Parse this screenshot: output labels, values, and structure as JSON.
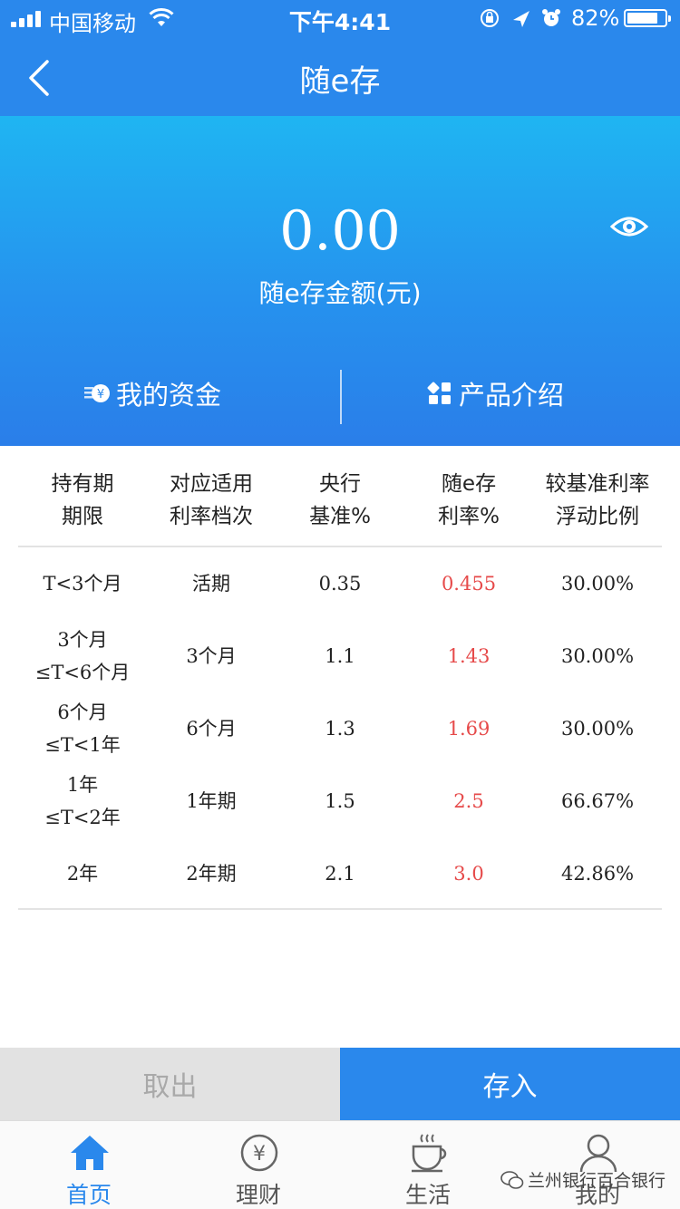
{
  "status_bar": {
    "carrier": "中国移动",
    "time": "下午4:41",
    "battery_percent": "82%",
    "battery_level": 0.82
  },
  "nav": {
    "title": "随e存",
    "back_icon": "chevron-left-icon"
  },
  "hero": {
    "amount": "0.00",
    "amount_label": "随e存金额(元)",
    "eye_icon": "eye-icon",
    "tabs": [
      {
        "label": "我的资金",
        "icon": "coin-yen-icon"
      },
      {
        "label": "产品介绍",
        "icon": "grid-apps-icon"
      }
    ]
  },
  "table": {
    "headers": [
      [
        "持有期",
        "期限"
      ],
      [
        "对应适用",
        "利率档次"
      ],
      [
        "央行",
        "基准%"
      ],
      [
        "随e存",
        "利率%"
      ],
      [
        "较基准利率",
        "浮动比例"
      ]
    ],
    "rows": [
      {
        "period": [
          "T<3个月"
        ],
        "tier": "活期",
        "base": "0.35",
        "rate": "0.455",
        "float": "30.00%"
      },
      {
        "period": [
          "3个月",
          "≤T<6个月"
        ],
        "tier": "3个月",
        "base": "1.1",
        "rate": "1.43",
        "float": "30.00%"
      },
      {
        "period": [
          "6个月",
          "≤T<1年"
        ],
        "tier": "6个月",
        "base": "1.3",
        "rate": "1.69",
        "float": "30.00%"
      },
      {
        "period": [
          "1年",
          "≤T<2年"
        ],
        "tier": "1年期",
        "base": "1.5",
        "rate": "2.5",
        "float": "66.67%"
      },
      {
        "period": [
          "2年"
        ],
        "tier": "2年期",
        "base": "2.1",
        "rate": "3.0",
        "float": "42.86%"
      }
    ],
    "rate_color": "#e64a4a"
  },
  "actions": {
    "withdraw_label": "取出",
    "deposit_label": "存入"
  },
  "tabbar": {
    "items": [
      {
        "label": "首页",
        "icon": "home-icon",
        "active": true
      },
      {
        "label": "理财",
        "icon": "yen-coin-icon",
        "active": false
      },
      {
        "label": "生活",
        "icon": "coffee-cup-icon",
        "active": false
      },
      {
        "label": "我的",
        "icon": "user-icon",
        "active": false
      }
    ]
  },
  "watermark": "兰州银行百合银行",
  "colors": {
    "brand_blue": "#2a88ec",
    "hero_top": "#1fb5f2",
    "rate_red": "#e64a4a"
  }
}
